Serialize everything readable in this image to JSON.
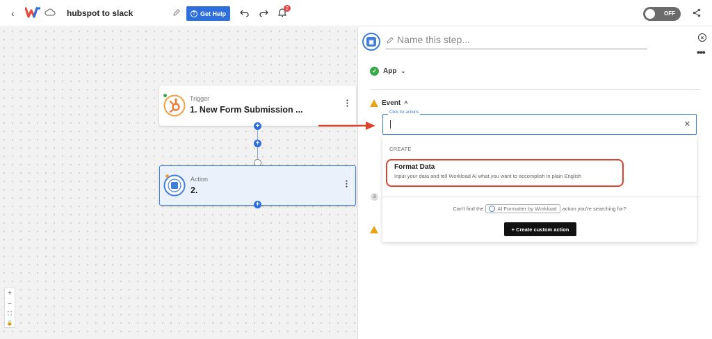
{
  "topbar": {
    "flow_name": "hubspot to slack",
    "help_label": "Get Help",
    "notification_count": "2",
    "toggle_label": "OFF"
  },
  "canvas": {
    "trigger": {
      "kind": "Trigger",
      "title": "1. New Form Submission ..."
    },
    "action": {
      "kind": "Action",
      "title": "2."
    },
    "zoom_controls": [
      "+",
      "−",
      "⛶",
      "🔒"
    ]
  },
  "panel": {
    "step_name_placeholder": "Name this step...",
    "app_label": "App",
    "event_label": "Event",
    "field_label": "Click for actions",
    "field_value": "",
    "dropdown": {
      "section": "CREATE",
      "option_title": "Format Data",
      "option_desc": "Input your data and tell Workload AI what you want to accomplish in plain English",
      "notfound_pre": "Can't find the",
      "notfound_chip": "AI Formatter by Workload",
      "notfound_post": "action you're searching for?",
      "custom_button": "+ Create custom action"
    },
    "step3_number": "3"
  },
  "colors": {
    "primary": "#2f6fdc",
    "highlight": "#d9442e",
    "success": "#3aaa4a",
    "warning": "#e8a316"
  }
}
